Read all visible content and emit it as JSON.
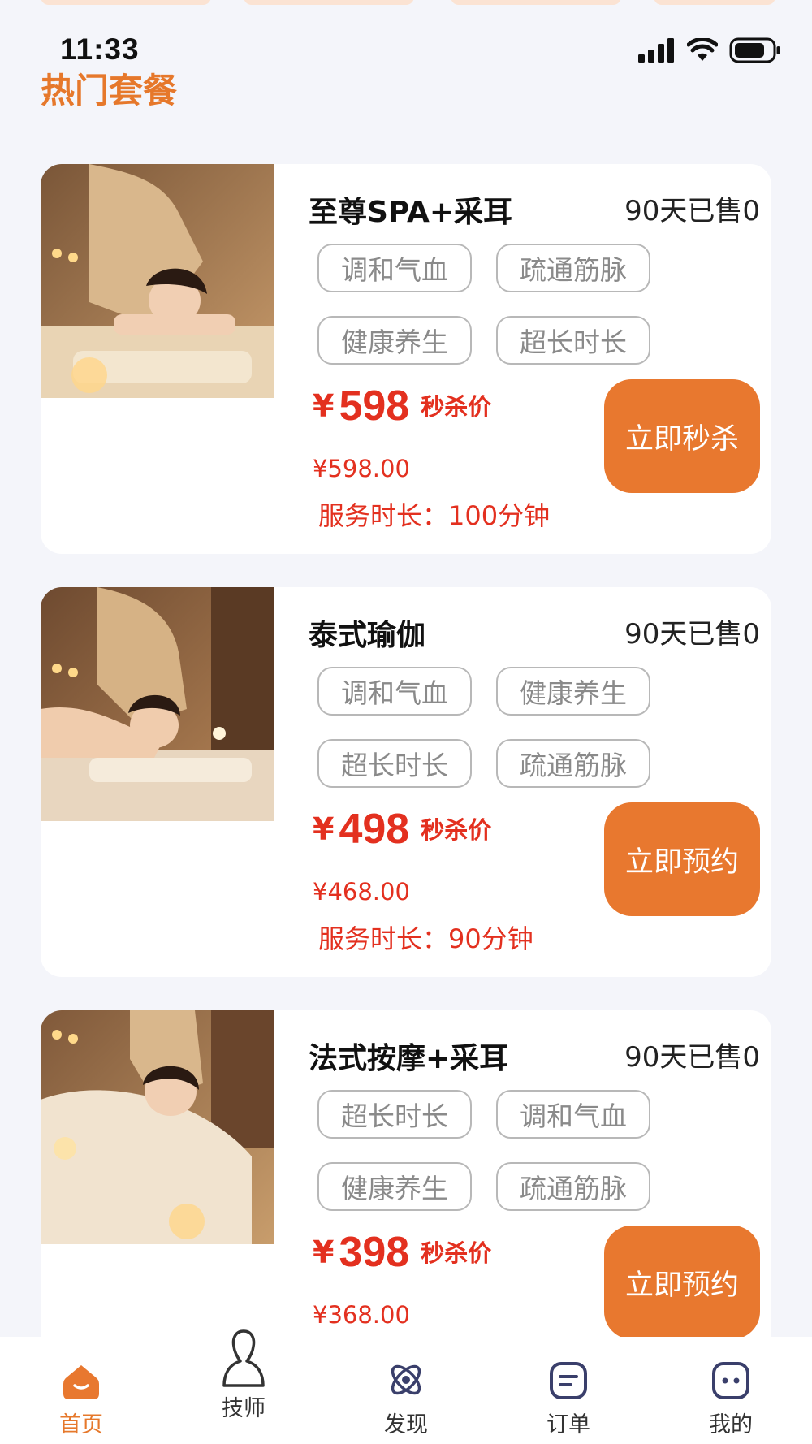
{
  "status_bar": {
    "time": "11:33"
  },
  "section": {
    "title": "热门套餐"
  },
  "packages": [
    {
      "name": "至尊SPA+采耳",
      "sold": "90天已售0",
      "tags": [
        "调和气血",
        "疏通筋脉",
        "健康养生",
        "超长时长"
      ],
      "currency": "¥",
      "price": "598",
      "price_label": "秒杀价",
      "original_price": "¥598.00",
      "duration": "服务时长：100分钟",
      "action": "立即秒杀"
    },
    {
      "name": "泰式瑜伽",
      "sold": "90天已售0",
      "tags": [
        "调和气血",
        "健康养生",
        "超长时长",
        "疏通筋脉"
      ],
      "currency": "¥",
      "price": "498",
      "price_label": "秒杀价",
      "original_price": "¥468.00",
      "duration": "服务时长：90分钟",
      "action": "立即预约"
    },
    {
      "name": "法式按摩+采耳",
      "sold": "90天已售0",
      "tags": [
        "超长时长",
        "调和气血",
        "健康养生",
        "疏通筋脉"
      ],
      "currency": "¥",
      "price": "398",
      "price_label": "秒杀价",
      "original_price": "¥368.00",
      "action": "立即预约"
    }
  ],
  "tabbar": {
    "items": [
      {
        "label": "首页",
        "icon": "home-icon",
        "active": true
      },
      {
        "label": "技师",
        "icon": "technician-icon",
        "active": false
      },
      {
        "label": "发现",
        "icon": "discover-icon",
        "active": false
      },
      {
        "label": "订单",
        "icon": "order-icon",
        "active": false
      },
      {
        "label": "我的",
        "icon": "profile-icon",
        "active": false
      }
    ]
  },
  "colors": {
    "accent": "#e8782f",
    "price": "#e3301f",
    "title": "#e6782b",
    "background": "#f4f5fa"
  }
}
